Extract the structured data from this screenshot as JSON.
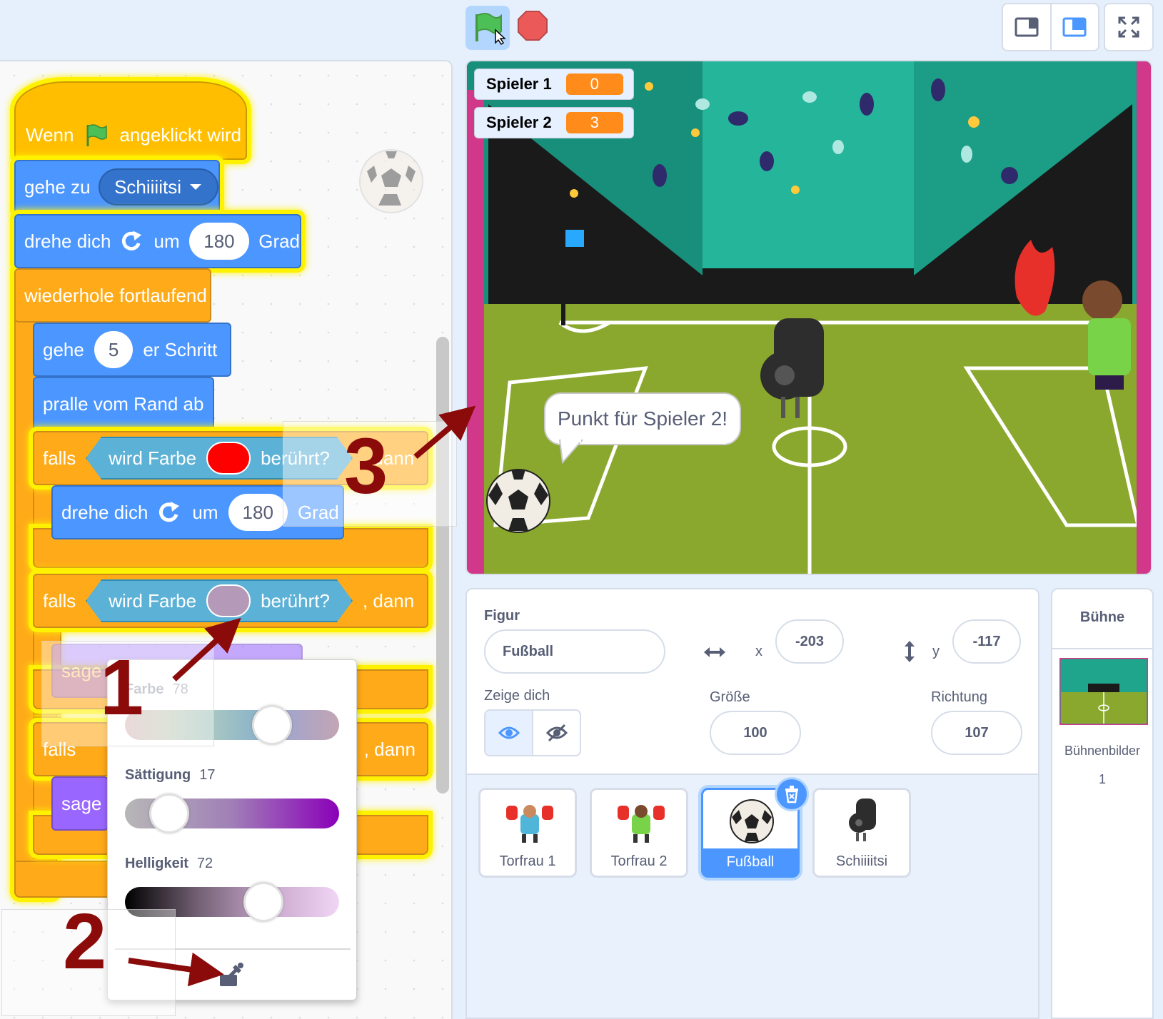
{
  "toolbar": {
    "green_flag": "green-flag-icon",
    "stop": "stop-sign-icon",
    "modes": [
      "small-stage-icon",
      "normal-stage-icon"
    ],
    "fullscreen": "fullscreen-icon"
  },
  "code": {
    "hat": {
      "pre": "Wenn",
      "post": "angeklickt wird"
    },
    "goto": {
      "label": "gehe zu",
      "target": "Schiiiitsi"
    },
    "turn1": {
      "pre": "drehe dich",
      "mid": "um",
      "value": "180",
      "post": "Grad"
    },
    "forever": "wiederhole fortlaufend",
    "move": {
      "pre": "gehe",
      "value": "5",
      "post": "er Schritt"
    },
    "bounce": "pralle vom Rand ab",
    "if1": {
      "falls": "falls",
      "sensing": "wird Farbe",
      "touched": "berührt?",
      "then": ", dann",
      "color": "#ff0000"
    },
    "turn2": {
      "pre": "drehe dich",
      "mid": "um",
      "value": "180",
      "post": "Grad"
    },
    "if2": {
      "falls": "falls",
      "sensing": "wird Farbe",
      "touched": "berührt?",
      "then": ", dann",
      "color": "#b49ab8"
    },
    "say1": "sage",
    "if3": {
      "falls": "falls",
      "then": ", dann"
    },
    "say2": "sage"
  },
  "picker": {
    "farbe_label": "Farbe",
    "farbe_value": "78",
    "saettigung_label": "Sättigung",
    "saettigung_value": "17",
    "helligkeit_label": "Helligkeit",
    "helligkeit_value": "72",
    "eyedropper": "eyedropper-icon"
  },
  "annotations": [
    "1",
    "2",
    "3"
  ],
  "stage": {
    "monitors": [
      {
        "label": "Spieler 1",
        "value": "0"
      },
      {
        "label": "Spieler 2",
        "value": "3"
      }
    ],
    "speech": "Punkt für Spieler 2!"
  },
  "sprite_info": {
    "figur_label": "Figur",
    "name": "Fußball",
    "x_label": "x",
    "x": "-203",
    "y_label": "y",
    "y": "-117",
    "show_label": "Zeige dich",
    "size_label": "Größe",
    "size": "100",
    "direction_label": "Richtung",
    "direction": "107"
  },
  "sprites": [
    {
      "name": "Torfrau 1"
    },
    {
      "name": "Torfrau 2"
    },
    {
      "name": "Fußball",
      "selected": true
    },
    {
      "name": "Schiiiitsi"
    }
  ],
  "stage_panel": {
    "title": "Bühne",
    "backdrops_label": "Bühnenbilder",
    "backdrops_count": "1"
  }
}
